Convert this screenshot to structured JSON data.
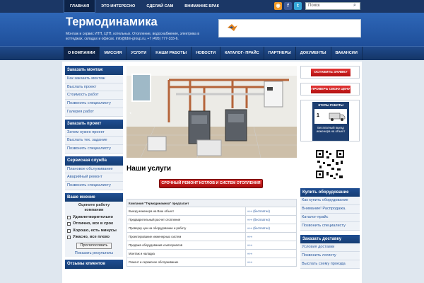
{
  "topnav": {
    "items": [
      {
        "label": "ГЛАВНАЯ"
      },
      {
        "label": "ЭТО ИНТЕРЕСНО"
      },
      {
        "label": "СДЕЛАЙ САМ"
      },
      {
        "label": "ВНИМАНИЕ БРАК"
      }
    ],
    "search_placeholder": "Поиск"
  },
  "header": {
    "title": "Термодинамика",
    "description": "Монтаж и сервис ИТП, ЦТП, котельных. Отопление, водоснабжение, электрика в коттеджах, складах и офисах. info@tdm-group.ru, +7 (495) 777-333-6."
  },
  "mainnav": {
    "items": [
      {
        "label": "О КОМПАНИИ"
      },
      {
        "label": "МИССИЯ"
      },
      {
        "label": "УСЛУГИ"
      },
      {
        "label": "НАШИ РАБОТЫ"
      },
      {
        "label": "НОВОСТИ"
      },
      {
        "label": "КАТАЛОГ- ПРАЙС"
      },
      {
        "label": "ПАРТНЕРЫ"
      },
      {
        "label": "ДОКУМЕНТЫ"
      },
      {
        "label": "ВАКАНСИИ"
      }
    ]
  },
  "left": {
    "box1": {
      "title": "Заказать монтаж",
      "items": [
        "Как заказать монтаж",
        "Выслать проект",
        "Стоимость работ",
        "Позвонить специалисту",
        "Галерея работ"
      ]
    },
    "box2": {
      "title": "Заказать проект",
      "items": [
        "Зачем нужен проект",
        "Выслать тех. задание",
        "Позвонить специалисту"
      ]
    },
    "box3": {
      "title": "Сервисная служба",
      "items": [
        "Плановое обслуживание",
        "Аварийный ремонт",
        "Позвонить специалисту"
      ]
    },
    "poll": {
      "title": "Ваше мнение",
      "question": "Оцените работу компании",
      "options": [
        "Удовлетворительно",
        "Отлично, все в срок",
        "Хорошо, есть минусы",
        "Ужасно, все плохо"
      ],
      "vote": "Проголосовать",
      "results": "Показать результаты"
    },
    "box4": {
      "title": "Отзывы клиентов"
    }
  },
  "main": {
    "heading": "Наши услуги",
    "cta": "СРОЧНЫЙ РЕМОНТ КОТЛОВ И СИСТЕМ ОТОПЛЕНИЯ",
    "table_header": "Компания \"Термодинамика\" предлагает",
    "rows": [
      {
        "service": "Выезд инженера на Ваш объект",
        "price": "»»» (бесплатно)"
      },
      {
        "service": "Предварительный расчет отопления",
        "price": "»»» (бесплатно)"
      },
      {
        "service": "Проверку цен на оборудование и работу",
        "price": "»»» (бесплатно)"
      },
      {
        "service": "Проектирование инженерных систем",
        "price": "»»»"
      },
      {
        "service": "Продажа оборудования и материалов",
        "price": "»»»"
      },
      {
        "service": "Монтаж и наладка",
        "price": "»»»"
      },
      {
        "service": "Ремонт и сервисное обслуживание",
        "price": "»»»"
      }
    ]
  },
  "right": {
    "btn1": "ОСТАВИТЬ ЗАЯВКУ",
    "btn2": "ПРОВЕРЬ СВОЮ ЦЕНУ",
    "stages": {
      "title": "ЭТАПЫ РАБОТЫ",
      "number": "1",
      "caption": "Бесплатный выезд инженера на объект"
    },
    "box1": {
      "title": "Купить оборудование",
      "items": [
        "Как купить оборудование",
        "Внимание! Распродажа.",
        "Каталог-прайс",
        "Позвонить специалисту"
      ]
    },
    "box2": {
      "title": "Заказать доставку",
      "items": [
        "Условия доставки",
        "Позвонить логисту",
        "Выслать схему проезда"
      ]
    }
  },
  "colors": {
    "brand": "#1f4f9a",
    "accent_red": "#c41818",
    "nav_dark": "#1b3766"
  }
}
